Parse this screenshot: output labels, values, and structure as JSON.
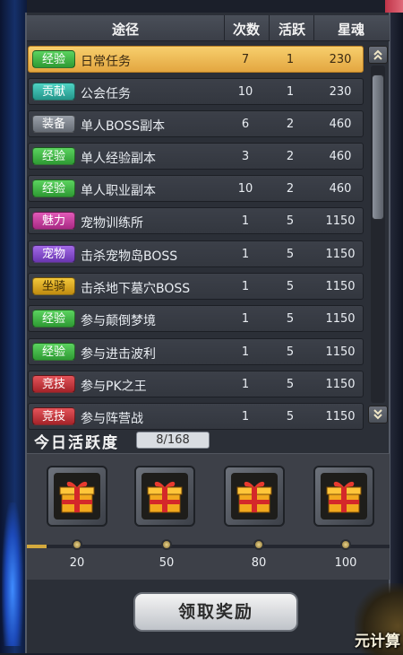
{
  "header": {
    "source": "途径",
    "times": "次数",
    "active": "活跃",
    "soul": "星魂"
  },
  "rows": [
    {
      "tag": "经验",
      "tag_color": "#3fb544",
      "name": "日常任务",
      "times": "7",
      "active": "1",
      "soul": "230",
      "selected": true
    },
    {
      "tag": "贡献",
      "tag_color": "#2fb3a6",
      "name": "公会任务",
      "times": "10",
      "active": "1",
      "soul": "230"
    },
    {
      "tag": "装备",
      "tag_color": "#80868f",
      "name": "单人BOSS副本",
      "times": "6",
      "active": "2",
      "soul": "460"
    },
    {
      "tag": "经验",
      "tag_color": "#3fb544",
      "name": "单人经验副本",
      "times": "3",
      "active": "2",
      "soul": "460"
    },
    {
      "tag": "经验",
      "tag_color": "#3fb544",
      "name": "单人职业副本",
      "times": "10",
      "active": "2",
      "soul": "460"
    },
    {
      "tag": "魅力",
      "tag_color": "#c2409d",
      "name": "宠物训练所",
      "times": "1",
      "active": "5",
      "soul": "1150"
    },
    {
      "tag": "宠物",
      "tag_color": "#8550cc",
      "name": "击杀宠物岛BOSS",
      "times": "1",
      "active": "5",
      "soul": "1150"
    },
    {
      "tag": "坐骑",
      "tag_color": "#dcaa20",
      "name": "击杀地下墓穴BOSS",
      "times": "1",
      "active": "5",
      "soul": "1150"
    },
    {
      "tag": "经验",
      "tag_color": "#3fb544",
      "name": "参与颠倒梦境",
      "times": "1",
      "active": "5",
      "soul": "1150"
    },
    {
      "tag": "经验",
      "tag_color": "#3fb544",
      "name": "参与进击波利",
      "times": "1",
      "active": "5",
      "soul": "1150"
    },
    {
      "tag": "竞技",
      "tag_color": "#c43a40",
      "name": "参与PK之王",
      "times": "1",
      "active": "5",
      "soul": "1150"
    },
    {
      "tag": "竞技",
      "tag_color": "#c43a40",
      "name": "参与阵营战",
      "times": "1",
      "active": "5",
      "soul": "1150"
    }
  ],
  "today": {
    "label": "今日活跃度",
    "value": "8/168",
    "progress_value": 8,
    "progress_max": 168
  },
  "milestones": [
    {
      "label": "20",
      "icon": "gift-box-icon"
    },
    {
      "label": "50",
      "icon": "gift-box-icon"
    },
    {
      "label": "80",
      "icon": "gift-box-icon"
    },
    {
      "label": "100",
      "icon": "gift-box-icon"
    }
  ],
  "claim_button": "领取奖励",
  "watermark": "元计算",
  "colors": {
    "selected_row": "#f0c25a",
    "progress_fill": "#d4a93d"
  }
}
